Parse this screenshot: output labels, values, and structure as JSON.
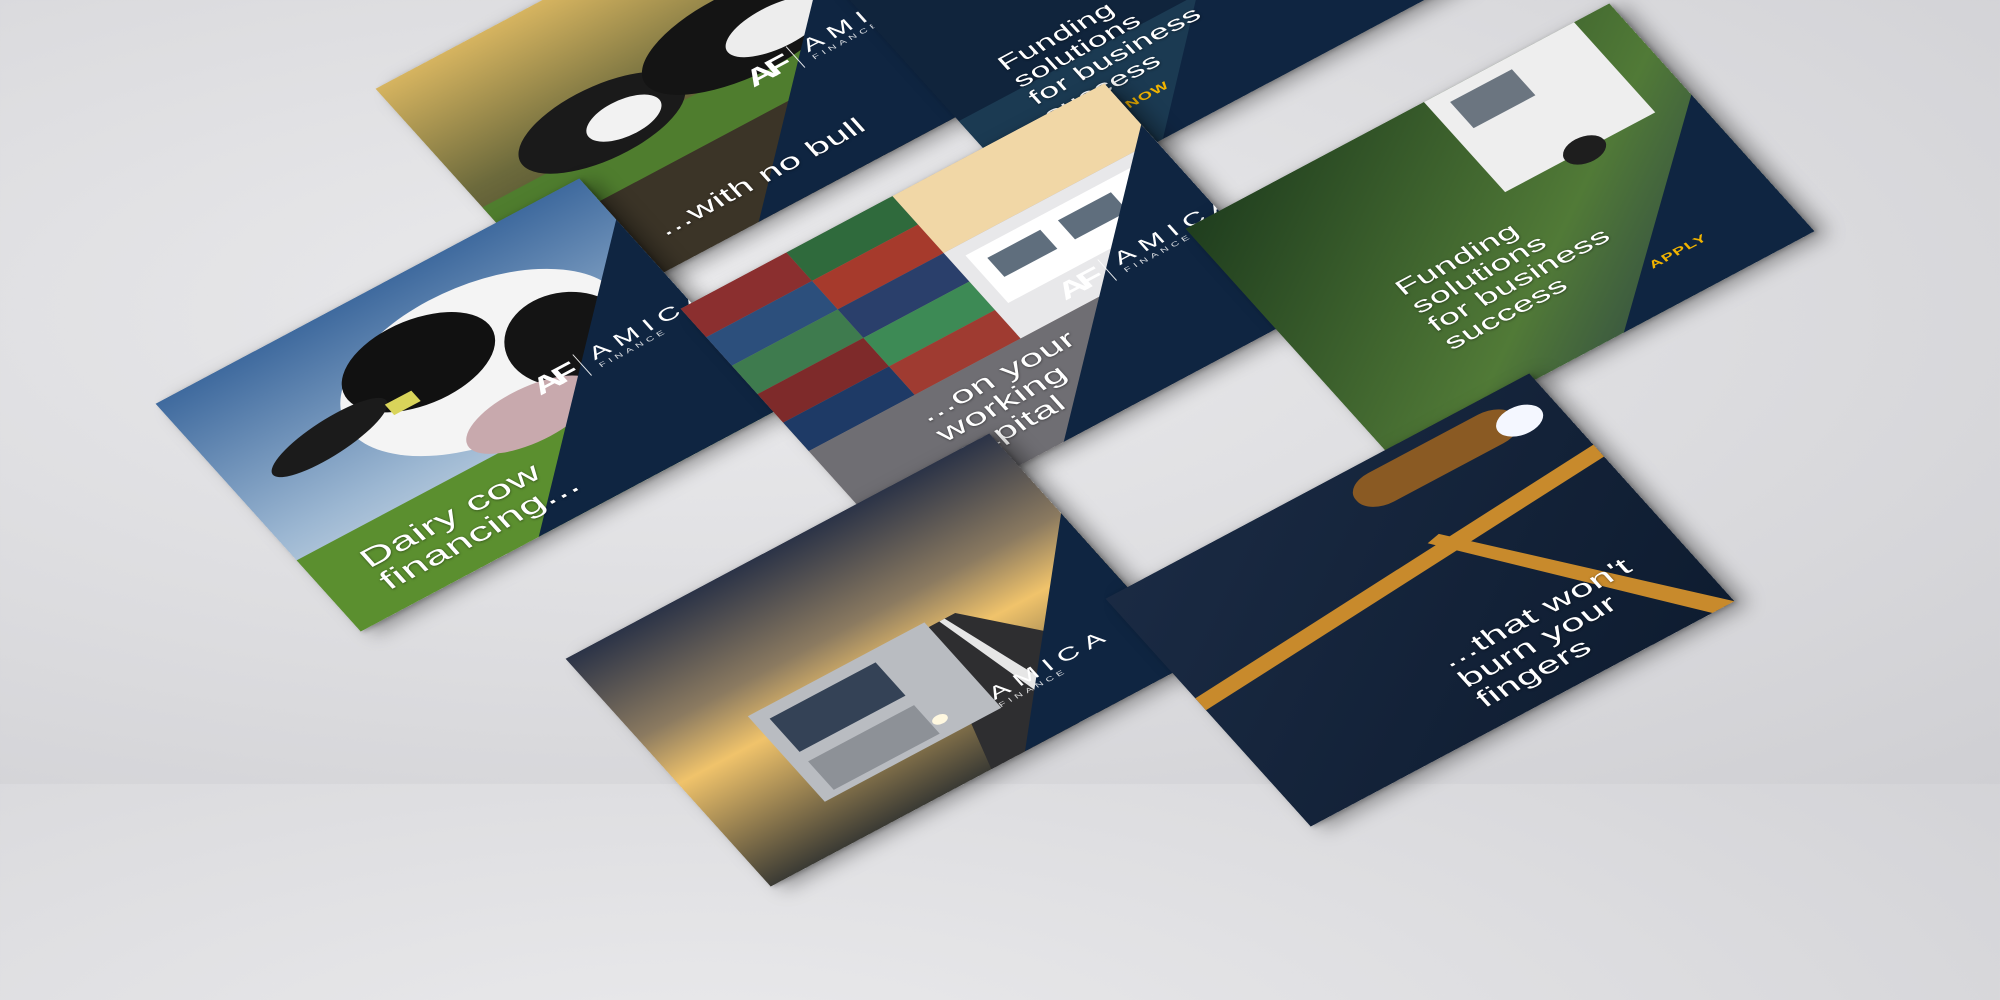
{
  "brand": {
    "name": "AMICA",
    "sub": "FINANCE",
    "mark": "AF",
    "colors": {
      "navy": "#0f2541",
      "cta": "#f2b400"
    }
  },
  "cards": {
    "cow_closeup": {
      "headline": [
        "Dairy cow",
        "financing..."
      ]
    },
    "cows_feeding": {
      "headline": [
        "...with no bull"
      ]
    },
    "containers_trucks": {
      "headline": [
        "...on your",
        "working",
        "capital"
      ]
    },
    "funding_top": {
      "headline": [
        "Funding",
        "solutions",
        "for business",
        "success"
      ],
      "cta": "APPLY NOW"
    },
    "funding_right": {
      "headline": [
        "Funding",
        "solutions",
        "for business",
        "success"
      ],
      "cta": "APPLY"
    },
    "truck_sunset": {},
    "steel_weld": {
      "headline": [
        "...that won't",
        "burn your",
        "fingers"
      ]
    }
  }
}
